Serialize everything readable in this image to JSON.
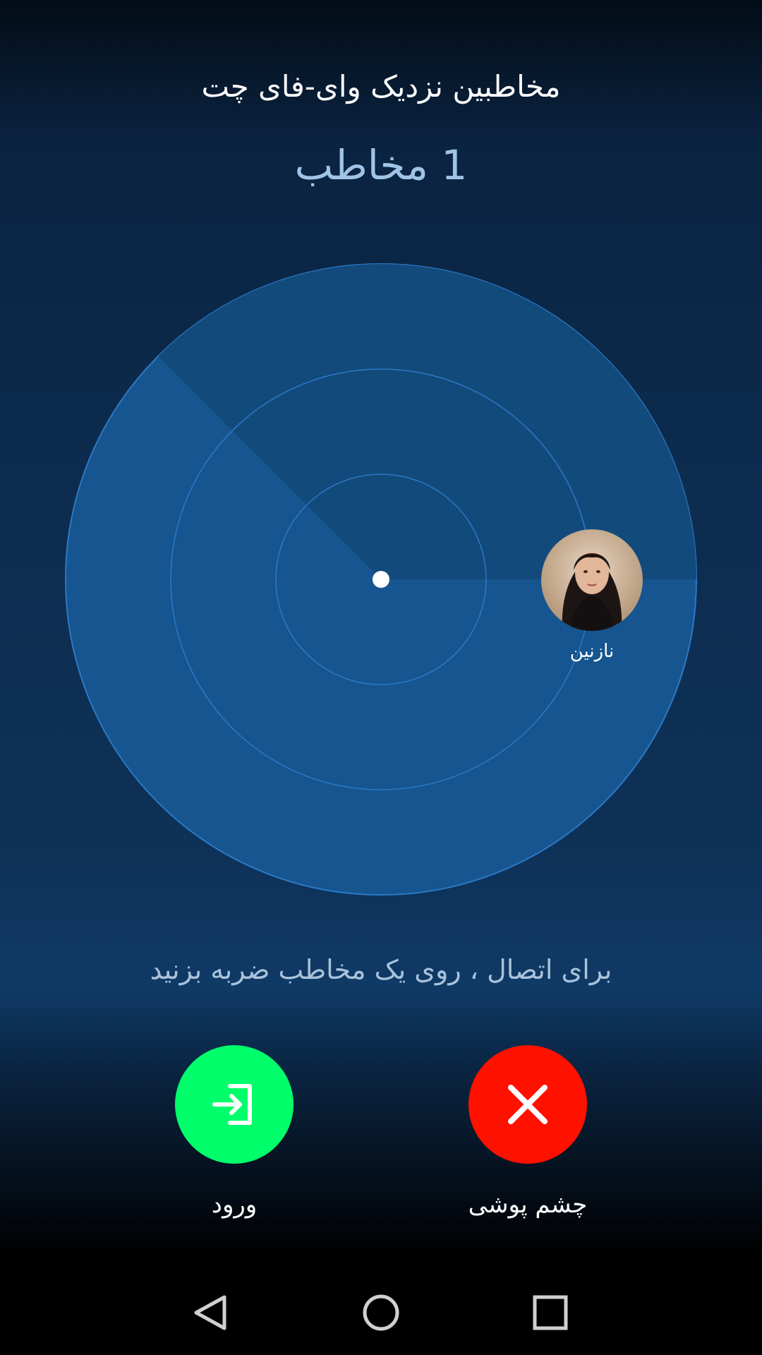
{
  "header": {
    "title": "مخاطبین نزدیک وای-فای چت",
    "count_label": "1 مخاطب"
  },
  "radar": {
    "contact": {
      "name": "نازنین",
      "avatar_icon": "contact-avatar-photo"
    }
  },
  "hint": "برای اتصال ، روی یک مخاطب ضربه بزنید",
  "actions": {
    "login": {
      "label": "ورود",
      "icon": "login-icon",
      "color": "#00ff6a"
    },
    "ignore": {
      "label": "چشم پوشی",
      "icon": "close-icon",
      "color": "#ff1100"
    }
  },
  "navbar": {
    "back_icon": "back-triangle-icon",
    "home_icon": "home-circle-icon",
    "recents_icon": "recents-square-icon"
  },
  "colors": {
    "radar_fill": "#16558f",
    "radar_ring": "#2b79c6",
    "sweep": "#134a7c"
  }
}
